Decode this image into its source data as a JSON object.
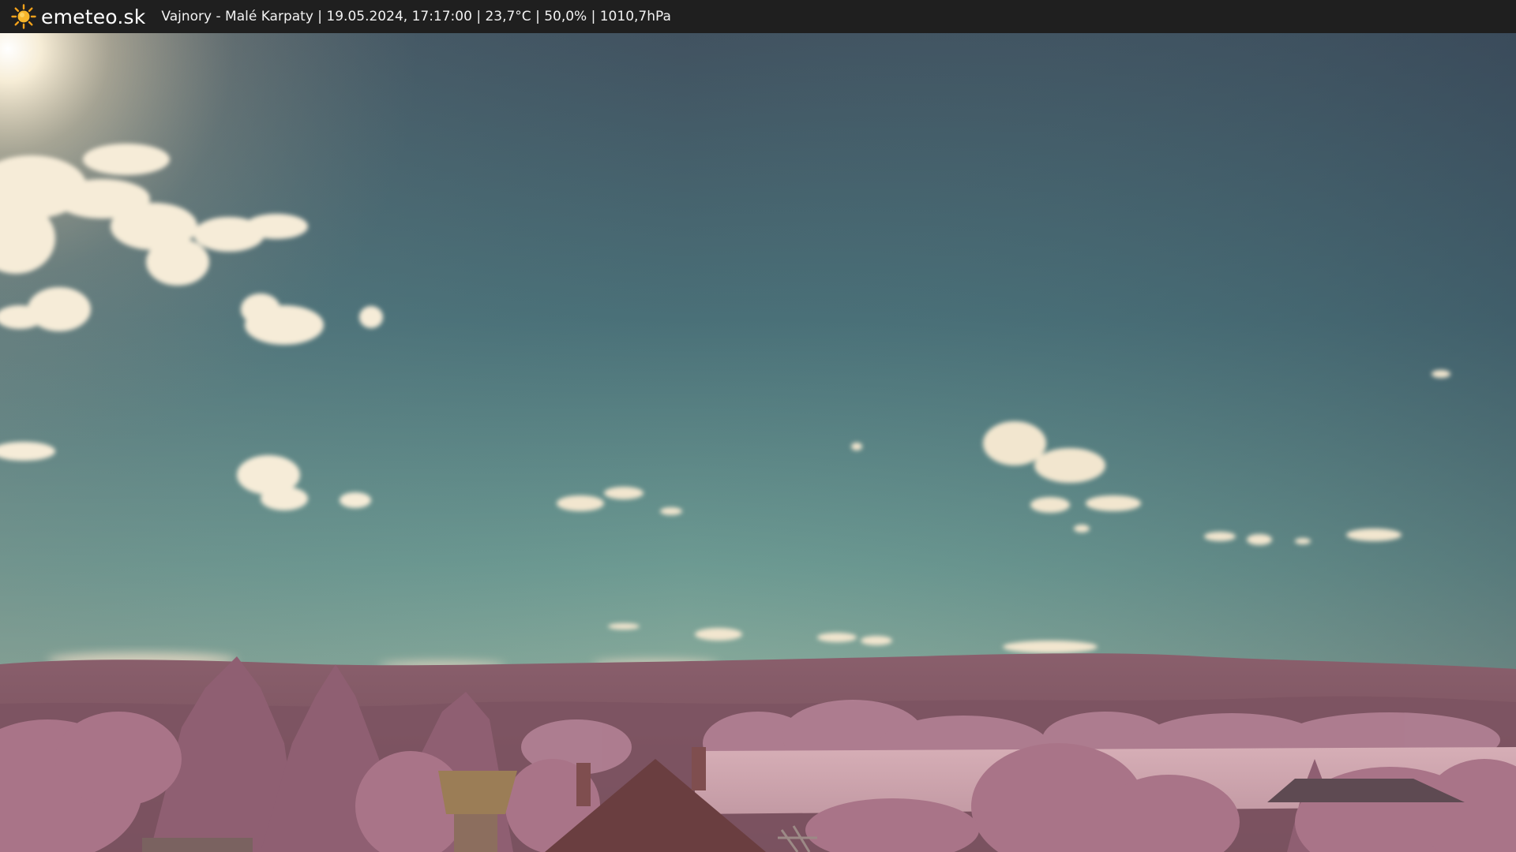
{
  "header": {
    "logo_icon": "sun-icon",
    "brand": "emeteo.sk",
    "caption": "Vajnory - Malé Karpaty | 19.05.2024, 17:17:00 | 23,7°C | 50,0% | 1010,7hPa"
  },
  "colors": {
    "bar_bg": "#1f1f1f",
    "sky_top": "#3e4d5c",
    "sky_mid": "#4d7f86",
    "sky_horizon": "#8fae9d",
    "hills": "#8a5f6c",
    "foliage": "#b07f92",
    "sun_glow": "#fff4dc"
  }
}
